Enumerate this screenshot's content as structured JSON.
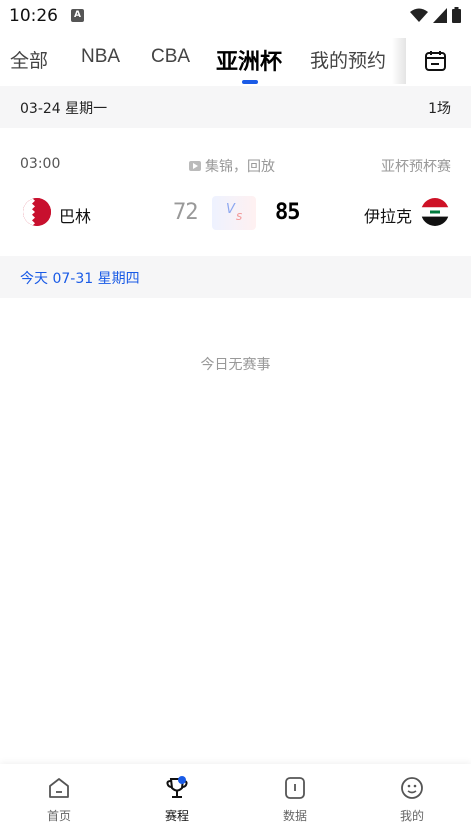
{
  "status_bar": {
    "time": "10:26",
    "notification_icon": "A"
  },
  "tabs": [
    {
      "label": "全部"
    },
    {
      "label": "NBA"
    },
    {
      "label": "CBA"
    },
    {
      "label": "亚洲杯",
      "active": true
    },
    {
      "label": "我的预约"
    }
  ],
  "sections": [
    {
      "date": "03-24  星期一",
      "count": "1场",
      "matches": [
        {
          "time": "03:00",
          "replay_label": "集锦，回放",
          "league": "亚杯预杯赛",
          "home_team": "巴林",
          "home_score": "72",
          "away_team": "伊拉克",
          "away_score": "85",
          "vs_label": "Vs"
        }
      ]
    },
    {
      "date": "今天  07-31  星期四",
      "empty_message": "今日无赛事"
    }
  ],
  "bottom_nav": [
    {
      "label": "首页",
      "icon": "home-icon"
    },
    {
      "label": "赛程",
      "icon": "trophy-icon",
      "active": true
    },
    {
      "label": "数据",
      "icon": "data-icon"
    },
    {
      "label": "我的",
      "icon": "profile-icon"
    }
  ],
  "colors": {
    "accent": "#1a5be6",
    "muted": "#999999",
    "section_bg": "#f6f6f7"
  }
}
